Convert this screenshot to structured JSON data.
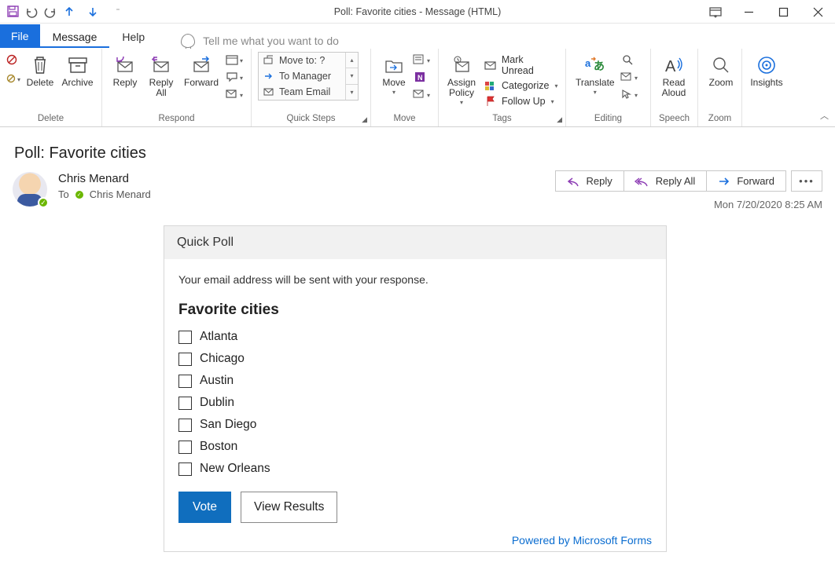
{
  "window": {
    "title": "Poll: Favorite cities  -  Message (HTML)"
  },
  "tabs": {
    "file": "File",
    "message": "Message",
    "help": "Help",
    "tellme": "Tell me what you want to do"
  },
  "ribbon": {
    "delete_group": {
      "label": "Delete",
      "delete": "Delete",
      "archive": "Archive"
    },
    "respond_group": {
      "label": "Respond",
      "reply": "Reply",
      "reply_all": "Reply\nAll",
      "forward": "Forward"
    },
    "quicksteps_group": {
      "label": "Quick Steps",
      "items": [
        "Move to: ?",
        "To Manager",
        "Team Email"
      ]
    },
    "move_group": {
      "label": "Move",
      "move": "Move"
    },
    "tags_group": {
      "label": "Tags",
      "assign_policy": "Assign\nPolicy",
      "mark_unread": "Mark Unread",
      "categorize": "Categorize",
      "follow_up": "Follow Up"
    },
    "editing_group": {
      "label": "Editing",
      "translate": "Translate"
    },
    "speech_group": {
      "label": "Speech",
      "read_aloud": "Read\nAloud"
    },
    "zoom_group": {
      "label": "Zoom",
      "zoom": "Zoom"
    },
    "insights_group": {
      "label": "",
      "insights": "Insights"
    }
  },
  "message": {
    "subject": "Poll: Favorite cities",
    "sender": "Chris Menard",
    "to_label": "To",
    "to_value": "Chris Menard",
    "timestamp": "Mon 7/20/2020 8:25 AM",
    "actions": {
      "reply": "Reply",
      "reply_all": "Reply All",
      "forward": "Forward"
    }
  },
  "poll": {
    "header": "Quick Poll",
    "note": "Your email address will be sent with your response.",
    "question": "Favorite cities",
    "options": [
      "Atlanta",
      "Chicago",
      "Austin",
      "Dublin",
      "San Diego",
      "Boston",
      "New Orleans"
    ],
    "vote_btn": "Vote",
    "results_btn": "View Results",
    "powered_by": "Powered by Microsoft Forms"
  }
}
